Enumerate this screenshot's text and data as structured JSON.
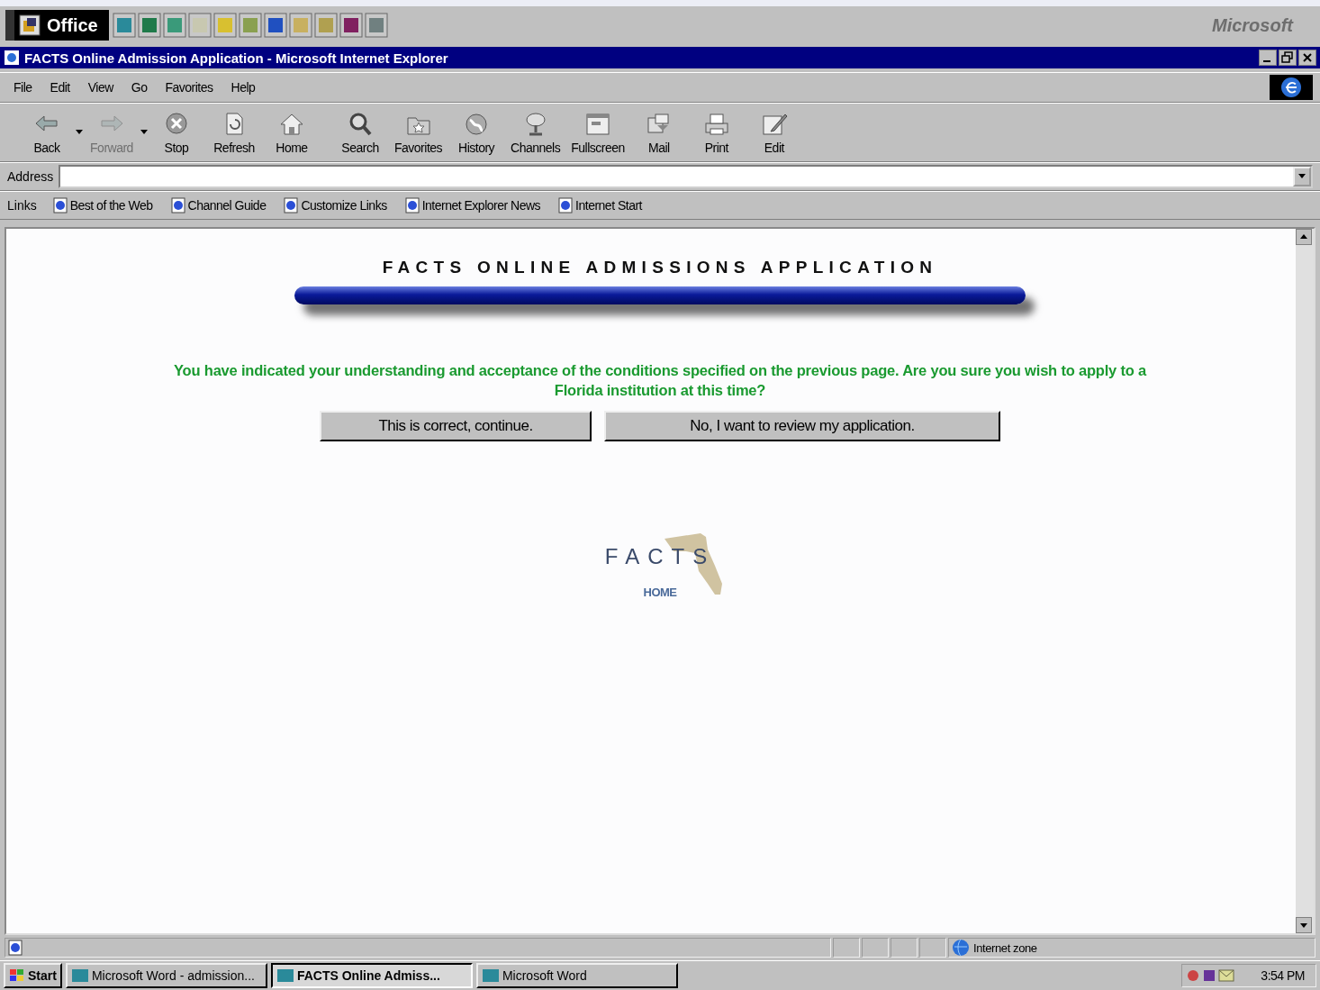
{
  "office_bar": {
    "label": "Office",
    "brand": "Microsoft"
  },
  "window": {
    "title": "FACTS Online Admission Application - Microsoft Internet Explorer",
    "menu": [
      "File",
      "Edit",
      "View",
      "Go",
      "Favorites",
      "Help"
    ],
    "toolbar": [
      {
        "label": "Back",
        "disabled": false,
        "dropdown": true
      },
      {
        "label": "Forward",
        "disabled": true,
        "dropdown": true
      },
      {
        "label": "Stop",
        "disabled": false,
        "dropdown": false
      },
      {
        "label": "Refresh",
        "disabled": false,
        "dropdown": false
      },
      {
        "label": "Home",
        "disabled": false,
        "dropdown": false
      },
      {
        "label": "Search",
        "disabled": false,
        "dropdown": false
      },
      {
        "label": "Favorites",
        "disabled": false,
        "dropdown": false
      },
      {
        "label": "History",
        "disabled": false,
        "dropdown": false
      },
      {
        "label": "Channels",
        "disabled": false,
        "dropdown": false
      },
      {
        "label": "Fullscreen",
        "disabled": false,
        "dropdown": false
      },
      {
        "label": "Mail",
        "disabled": false,
        "dropdown": false
      },
      {
        "label": "Print",
        "disabled": false,
        "dropdown": false
      },
      {
        "label": "Edit",
        "disabled": false,
        "dropdown": false
      }
    ],
    "address": {
      "label": "Address"
    },
    "links": {
      "label": "Links",
      "items": [
        "Best of the Web",
        "Channel Guide",
        "Customize Links",
        "Internet Explorer News",
        "Internet Start"
      ]
    }
  },
  "page": {
    "heading": "FACTS ONLINE ADMISSIONS APPLICATION",
    "message": "You have indicated your understanding and acceptance of the conditions specified on the previous page. Are you sure you wish to apply to a Florida institution at this time?",
    "buttons": [
      "This is correct, continue.",
      "No, I want to review my application."
    ],
    "logo": {
      "text": "FACTS",
      "link": "HOME"
    }
  },
  "status_bar": {
    "zone": "Internet zone"
  },
  "taskbar": {
    "start": "Start",
    "tasks": [
      {
        "label": "Microsoft Word - admission...",
        "selected": false
      },
      {
        "label": "FACTS Online Admiss...",
        "selected": true
      },
      {
        "label": "Microsoft Word",
        "selected": false
      }
    ],
    "clock": "3:54 PM"
  }
}
